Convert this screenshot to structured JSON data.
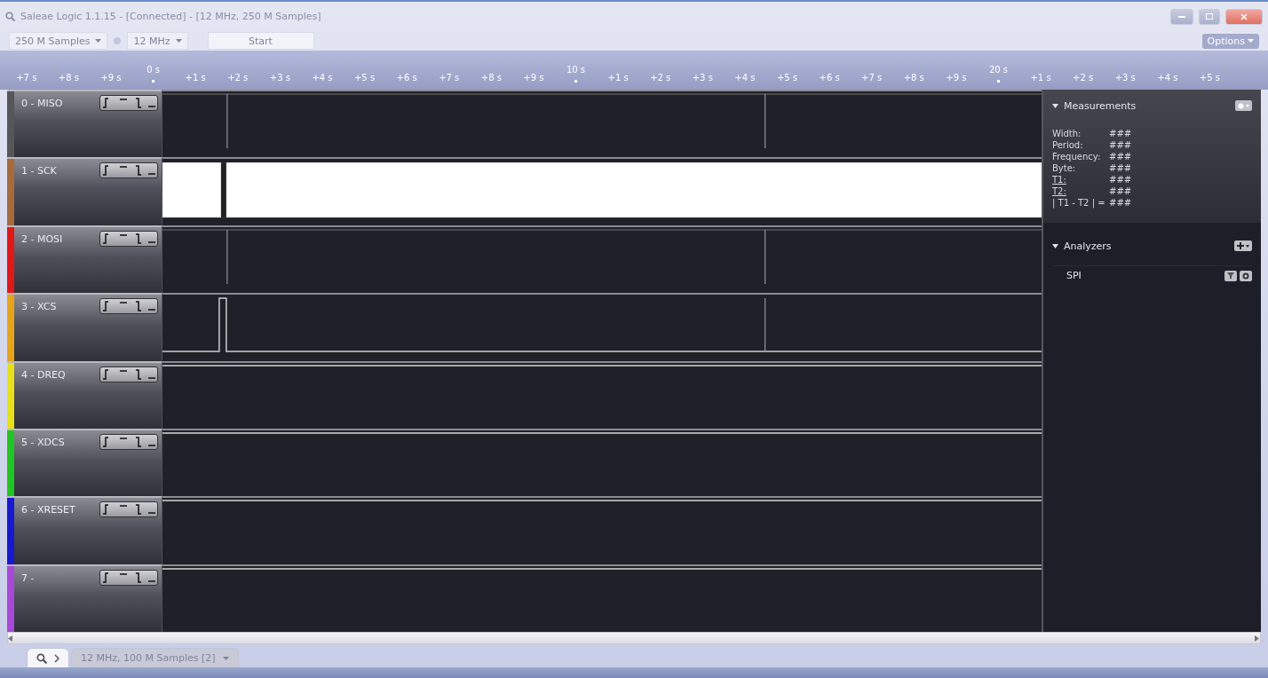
{
  "window": {
    "title": "Saleae Logic 1.1.15 - [Connected] - [12 MHz, 250 M Samples]"
  },
  "toolbar": {
    "samples": "250 M Samples",
    "rate": "12 MHz",
    "start": "Start",
    "options": "Options"
  },
  "ruler": [
    {
      "kind": "minor",
      "label": "+7 s"
    },
    {
      "kind": "minor",
      "label": "+8 s"
    },
    {
      "kind": "minor",
      "label": "+9 s"
    },
    {
      "kind": "major",
      "label": "0 s"
    },
    {
      "kind": "minor",
      "label": "+1 s"
    },
    {
      "kind": "minor",
      "label": "+2 s"
    },
    {
      "kind": "minor",
      "label": "+3 s"
    },
    {
      "kind": "minor",
      "label": "+4 s"
    },
    {
      "kind": "minor",
      "label": "+5 s"
    },
    {
      "kind": "minor",
      "label": "+6 s"
    },
    {
      "kind": "minor",
      "label": "+7 s"
    },
    {
      "kind": "minor",
      "label": "+8 s"
    },
    {
      "kind": "minor",
      "label": "+9 s"
    },
    {
      "kind": "major",
      "label": "10 s"
    },
    {
      "kind": "minor",
      "label": "+1 s"
    },
    {
      "kind": "minor",
      "label": "+2 s"
    },
    {
      "kind": "minor",
      "label": "+3 s"
    },
    {
      "kind": "minor",
      "label": "+4 s"
    },
    {
      "kind": "minor",
      "label": "+5 s"
    },
    {
      "kind": "minor",
      "label": "+6 s"
    },
    {
      "kind": "minor",
      "label": "+7 s"
    },
    {
      "kind": "minor",
      "label": "+8 s"
    },
    {
      "kind": "minor",
      "label": "+9 s"
    },
    {
      "kind": "major",
      "label": "20 s"
    },
    {
      "kind": "minor",
      "label": "+1 s"
    },
    {
      "kind": "minor",
      "label": "+2 s"
    },
    {
      "kind": "minor",
      "label": "+3 s"
    },
    {
      "kind": "minor",
      "label": "+4 s"
    },
    {
      "kind": "minor",
      "label": "+5 s"
    }
  ],
  "channels": [
    {
      "label": "0 - MISO",
      "color": "#55555a",
      "kind": "markers"
    },
    {
      "label": "1 - SCK",
      "color": "#a86a3a",
      "kind": "high"
    },
    {
      "label": "2 - MOSI",
      "color": "#e01818",
      "kind": "markers"
    },
    {
      "label": "3 - XCS",
      "color": "#e8a418",
      "kind": "pulse"
    },
    {
      "label": "4 - DREQ",
      "color": "#e8e018",
      "kind": "flat"
    },
    {
      "label": "5 - XDCS",
      "color": "#22c422",
      "kind": "flat"
    },
    {
      "label": "6 - XRESET",
      "color": "#1818d0",
      "kind": "flat"
    },
    {
      "label": "7 -",
      "color": "#a848d8",
      "kind": "flat"
    }
  ],
  "measurements": {
    "title": "Measurements",
    "expanded": true,
    "rows": [
      {
        "label": "Width:",
        "value": "###",
        "underlined": false
      },
      {
        "label": "Period:",
        "value": "###",
        "underlined": false
      },
      {
        "label": "Frequency:",
        "value": "###",
        "underlined": false
      },
      {
        "label": "Byte:",
        "value": "###",
        "underlined": false
      },
      {
        "label": "T1:",
        "value": "###",
        "underlined": true
      },
      {
        "label": "T2:",
        "value": "###",
        "underlined": true
      },
      {
        "label": "| T1 - T2 | =",
        "value": "###",
        "underlined": false
      }
    ]
  },
  "analyzers": {
    "title": "Analyzers",
    "expanded": true,
    "items": [
      {
        "name": "SPI"
      }
    ]
  },
  "tabs": [
    {
      "kind": "search",
      "selected": true
    },
    {
      "kind": "session",
      "label": "12 MHz, 100 M Samples [2]",
      "selected": false
    }
  ]
}
